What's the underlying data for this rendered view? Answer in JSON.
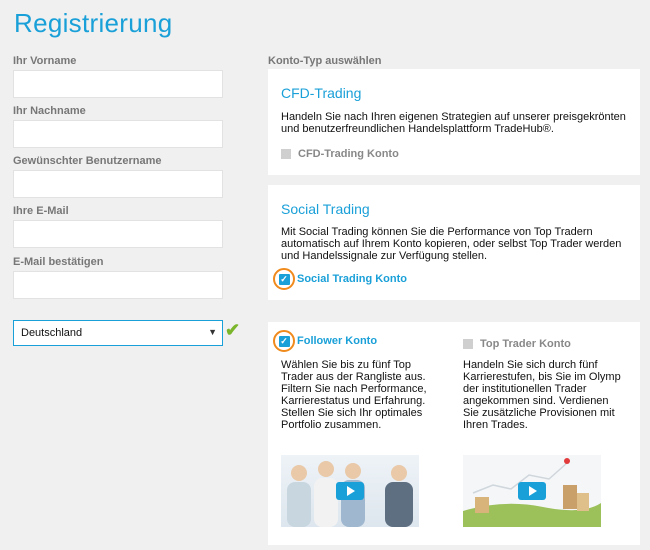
{
  "page": {
    "title": "Registrierung"
  },
  "form": {
    "first_name": {
      "label": "Ihr Vorname",
      "value": ""
    },
    "last_name": {
      "label": "Ihr Nachname",
      "value": ""
    },
    "username": {
      "label": "Gewünschter Benutzername",
      "value": ""
    },
    "email": {
      "label": "Ihre E-Mail",
      "value": ""
    },
    "email_confirm": {
      "label": "E-Mail bestätigen",
      "value": ""
    },
    "country": {
      "selected": "Deutschland"
    }
  },
  "account": {
    "section_label": "Konto-Typ auswählen",
    "cfd": {
      "title": "CFD-Trading",
      "description": "Handeln Sie nach Ihren eigenen Strategien auf unserer preisgekrönten und benutzerfreundlichen Handelsplattform TradeHub®.",
      "checkbox_label": "CFD-Trading Konto",
      "checked": false
    },
    "social": {
      "title": "Social Trading",
      "description": "Mit Social Trading können Sie die Performance von Top Tradern automatisch auf Ihrem Konto kopieren, oder selbst Top Trader werden und Handelssignale zur Verfügung stellen.",
      "checkbox_label": "Social Trading Konto",
      "checked": true
    },
    "follower": {
      "checkbox_label": "Follower Konto",
      "checked": true,
      "description": "Wählen Sie bis zu fünf Top Trader aus der Rangliste aus. Filtern Sie nach Performance, Karrierestatus und Erfahrung. Stellen Sie sich Ihr optimales Portfolio zusammen."
    },
    "top_trader": {
      "checkbox_label": "Top Trader Konto",
      "checked": false,
      "description": "Handeln Sie sich durch fünf Karrierestufen, bis Sie im Olymp der institutionellen Trader angekommen sind. Verdienen Sie zusätzliche Provisionen mit Ihren Trades."
    }
  },
  "colors": {
    "accent": "#1aa0d8",
    "highlight": "#f08a1c",
    "valid": "#7ab52b"
  }
}
